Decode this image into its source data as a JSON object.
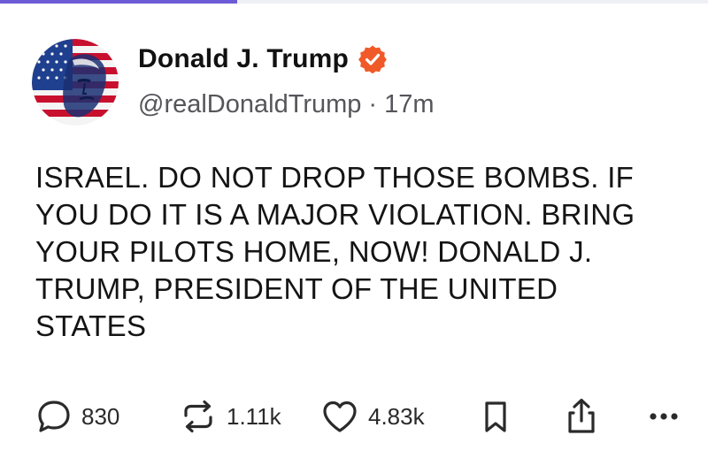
{
  "post": {
    "author": {
      "display_name": "Donald J. Trump",
      "handle": "@realDonaldTrump",
      "separator": "·",
      "time_ago": "17m",
      "avatar_icon": "flag-portrait-avatar",
      "verified_icon": "verified-badge-icon"
    },
    "text": "ISRAEL. DO NOT DROP THOSE BOMBS. IF\nYOU DO IT IS A MAJOR VIOLATION. BRING\nYOUR PILOTS HOME, NOW!  DONALD J.\nTRUMP, PRESIDENT OF THE UNITED\nSTATES",
    "actions": {
      "reply": {
        "icon": "reply-icon",
        "count": "830"
      },
      "repost": {
        "icon": "repost-icon",
        "count": "1.11k"
      },
      "like": {
        "icon": "heart-icon",
        "count": "4.83k"
      },
      "bookmark": {
        "icon": "bookmark-icon"
      },
      "share": {
        "icon": "share-icon"
      },
      "more": {
        "icon": "more-icon"
      }
    }
  },
  "colors": {
    "verified_badge": "#f05a28",
    "accent_bar": "#6b5bd6",
    "text_primary": "#111111",
    "text_secondary": "#55555a"
  }
}
